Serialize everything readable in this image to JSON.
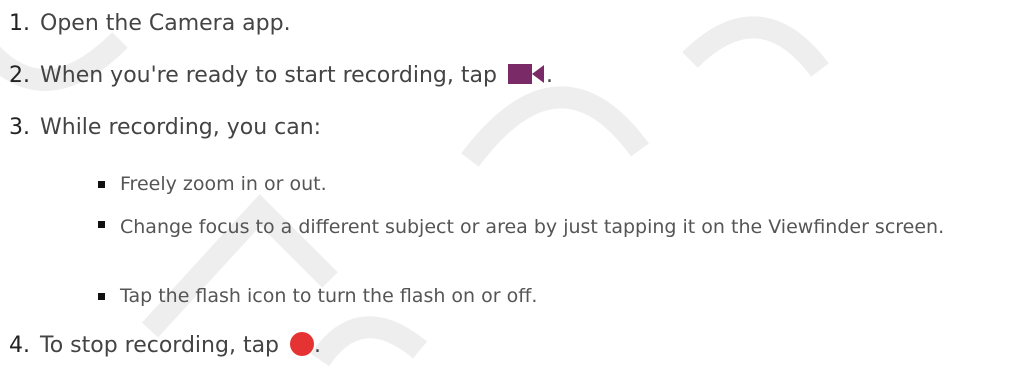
{
  "watermark": {
    "color": "#f3f3f3"
  },
  "steps": [
    {
      "number": "1.",
      "text": "Open the Camera app."
    },
    {
      "number": "2.",
      "text_before": "When you're ready to start recording, tap",
      "icon": "video-camera-icon",
      "text_after": "."
    },
    {
      "number": "3.",
      "text": "While recording, you can:"
    },
    {
      "number": "4.",
      "text_before": "To stop recording, tap",
      "icon": "record-stop-icon",
      "text_after": "."
    }
  ],
  "sub_items": [
    "Freely zoom in or out.",
    "Change focus to a different subject or area by just tapping it on the Viewfinder screen.",
    "Tap the flash icon to turn the flash on or off."
  ],
  "colors": {
    "text": "#444444",
    "record_icon": "#e53232",
    "camera_icon": "#7a2a66"
  }
}
